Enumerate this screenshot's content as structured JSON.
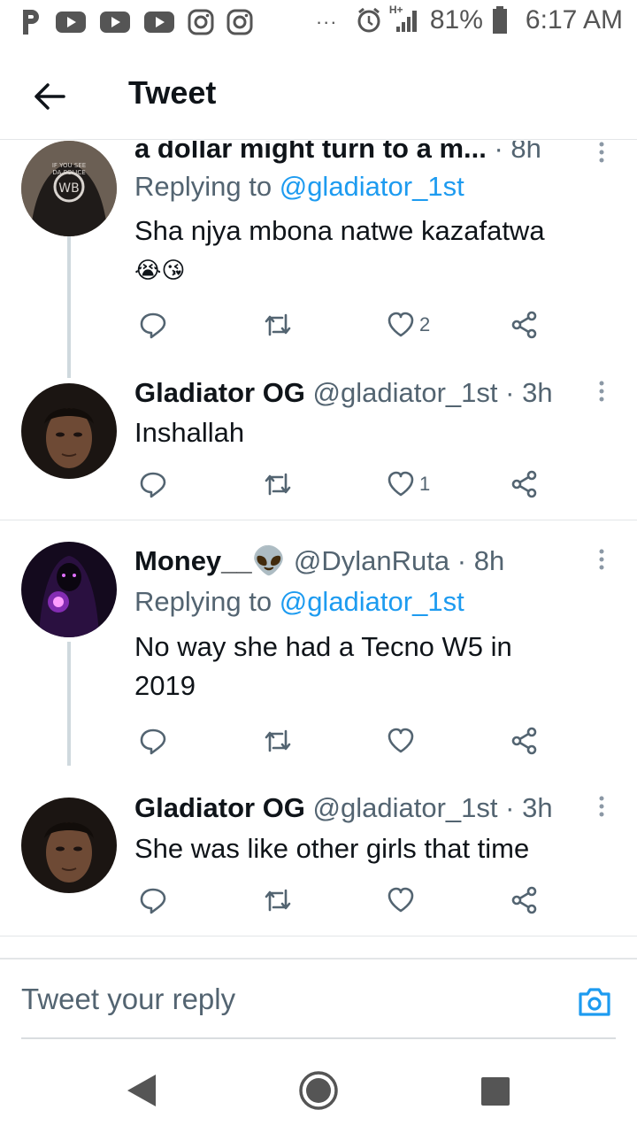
{
  "status_bar": {
    "battery": "81%",
    "time": "6:17 AM",
    "network": "H+",
    "overflow": "...",
    "icons": [
      "p-icon",
      "youtube-icon",
      "youtube-icon",
      "youtube-icon",
      "instagram-icon",
      "instagram-icon",
      "alarm-icon",
      "signal-icon",
      "battery-icon"
    ]
  },
  "header": {
    "title": "Tweet",
    "back_icon": "arrow-left-icon"
  },
  "tweets": [
    {
      "text_top": "a dollar might turn to a m...",
      "time": "8h",
      "replying_label": "Replying to",
      "replying_to": "@gladiator_1st",
      "text": "Sha njya mbona natwe kazafatwa",
      "emoji": "😭😘",
      "likes": "2"
    },
    {
      "name": "Gladiator OG",
      "handle": "@gladiator_1st",
      "dot": "·",
      "time": "3h",
      "text": "Inshallah",
      "likes": "1"
    },
    {
      "name": "Money__",
      "name_emoji": "👽",
      "handle": "@DylanRuta",
      "dot": "·",
      "time": "8h",
      "replying_label": "Replying to",
      "replying_to": "@gladiator_1st",
      "text": "No way she had a Tecno W5 in 2019",
      "likes": ""
    },
    {
      "name": "Gladiator OG",
      "handle": "@gladiator_1st",
      "dot": "·",
      "time": "3h",
      "text": "She was like other girls that time",
      "likes": ""
    }
  ],
  "composer": {
    "placeholder": "Tweet your reply",
    "camera_icon": "camera-icon"
  },
  "nav": {
    "icons": [
      "back-triangle-icon",
      "home-circle-icon",
      "recents-square-icon"
    ]
  },
  "colors": {
    "accent": "#1d9bf0",
    "secondary_text": "#536471",
    "divider": "#e3e6e8",
    "thread_line": "#cfd9de"
  }
}
